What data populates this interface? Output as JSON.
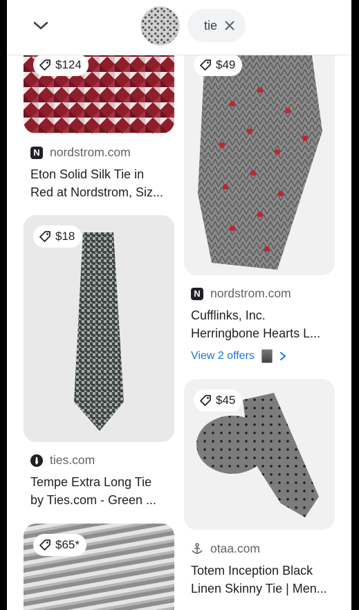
{
  "header": {
    "query": "tie",
    "collapse_icon": "chevron-down-icon",
    "clear_icon": "close-icon"
  },
  "results": [
    {
      "price": "$124",
      "source": "nordstrom.com",
      "title_line1": "Eton Solid Silk Tie in",
      "title_line2": "Red at Nordstrom, Siz..."
    },
    {
      "price": "$49",
      "source": "nordstrom.com",
      "title_line1": "Cufflinks, Inc.",
      "title_line2": "Herringbone Hearts L...",
      "offers": "View 2 offers"
    },
    {
      "price": "$18",
      "source": "ties.com",
      "title_line1": "Tempe Extra Long Tie",
      "title_line2": "by Ties.com - Green ..."
    },
    {
      "price": "$45",
      "source": "otaa.com",
      "title_line1": "Totem Inception Black",
      "title_line2": "Linen Skinny Tie | Men..."
    },
    {
      "price": "$65*"
    }
  ],
  "colors": {
    "link": "#1a73e8",
    "chip_bg": "#f1f3f4",
    "text": "#202124",
    "muted": "#5f6368"
  }
}
